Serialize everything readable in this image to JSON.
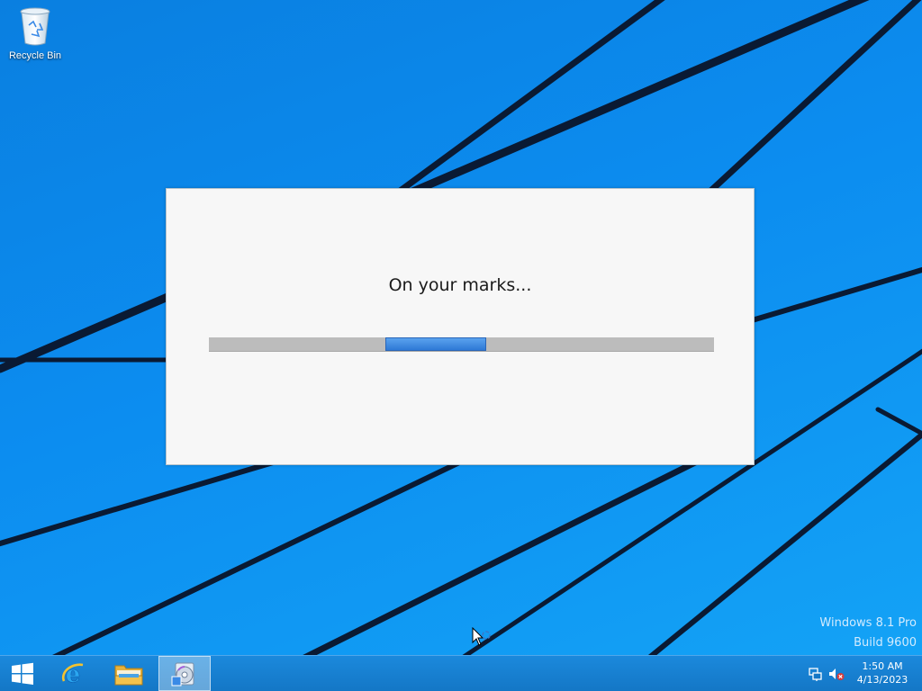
{
  "desktop": {
    "icons": [
      {
        "label": "Recycle Bin",
        "icon": "recycle-bin-icon"
      }
    ]
  },
  "dialog": {
    "message": "On your marks...",
    "progress_state": "indeterminate",
    "progress_fraction_start": 0.35,
    "progress_fraction_width": 0.2,
    "accent_color": "#3a8ae6"
  },
  "watermark": {
    "line1": "Windows 8.1 Pro",
    "line2": "Build 9600"
  },
  "taskbar": {
    "items": [
      {
        "name": "start",
        "icon": "windows-logo-icon"
      },
      {
        "name": "internet-explorer",
        "icon": "internet-explorer-icon"
      },
      {
        "name": "file-explorer",
        "icon": "folder-icon"
      },
      {
        "name": "setup",
        "icon": "setup-disc-icon",
        "active": true
      }
    ],
    "tray": {
      "icons": [
        "network-icon",
        "volume-muted-icon"
      ],
      "time": "1:50 AM",
      "date": "4/13/2023"
    },
    "color": "#1477c6"
  },
  "wallpaper": {
    "color": "#0c8df0"
  }
}
